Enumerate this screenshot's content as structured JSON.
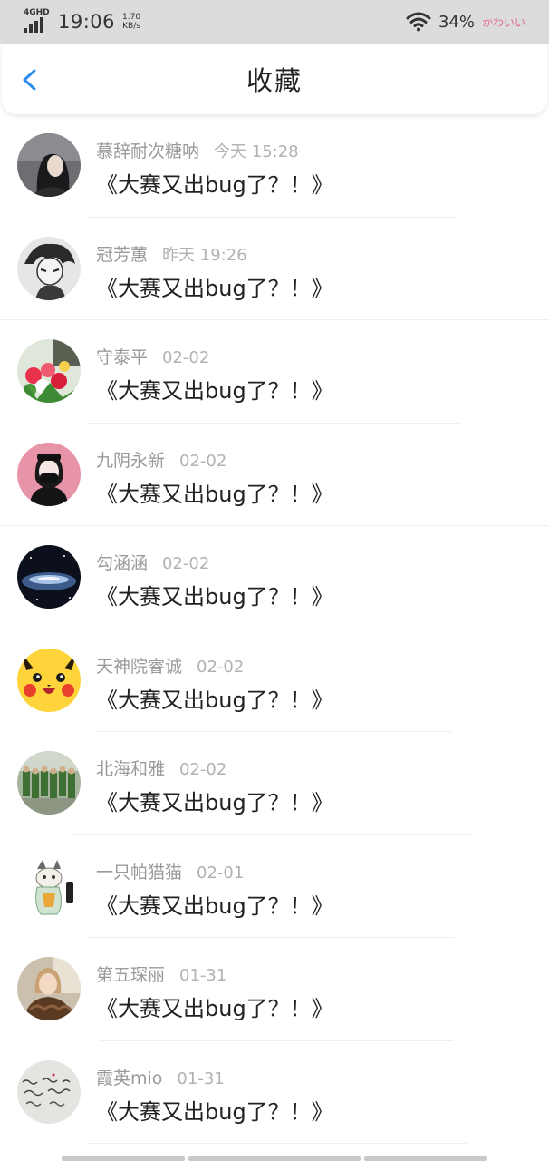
{
  "status_bar": {
    "network": "4GHD",
    "time": "19:06",
    "speed_value": "1.70",
    "speed_unit": "KB/s",
    "battery": "34%",
    "brand": "かわいい"
  },
  "header": {
    "title": "收藏"
  },
  "icons": {
    "back": "chevron-left-icon",
    "signal": "signal-icon",
    "wifi": "wifi-icon"
  },
  "favorites": [
    {
      "name": "慕辞耐次糖呐",
      "time": "今天 15:28",
      "title": "《大赛又出bug了？！》",
      "avatar": "avatar-girl-photo"
    },
    {
      "name": "冠芳蕙",
      "time": "昨天 19:26",
      "title": "《大赛又出bug了？！》",
      "avatar": "avatar-anime-sketch"
    },
    {
      "name": "守泰平",
      "time": "02-02",
      "title": "《大赛又出bug了？！》",
      "avatar": "avatar-flowers"
    },
    {
      "name": "九阴永新",
      "time": "02-02",
      "title": "《大赛又出bug了？！》",
      "avatar": "avatar-masked-girl"
    },
    {
      "name": "勾涵涵",
      "time": "02-02",
      "title": "《大赛又出bug了？！》",
      "avatar": "avatar-night-sky"
    },
    {
      "name": "天神院睿诚",
      "time": "02-02",
      "title": "《大赛又出bug了？！》",
      "avatar": "avatar-pikachu"
    },
    {
      "name": "北海和雅",
      "time": "02-02",
      "title": "《大赛又出bug了？！》",
      "avatar": "avatar-soldiers"
    },
    {
      "name": "一只帕猫猫",
      "time": "02-01",
      "title": "《大赛又出bug了？！》",
      "avatar": "avatar-cat-art"
    },
    {
      "name": "第五琛丽",
      "time": "01-31",
      "title": "《大赛又出bug了？！》",
      "avatar": "avatar-woman-fur"
    },
    {
      "name": "霞英mio",
      "time": "01-31",
      "title": "《大赛又出bug了？！》",
      "avatar": "avatar-handwriting"
    }
  ]
}
